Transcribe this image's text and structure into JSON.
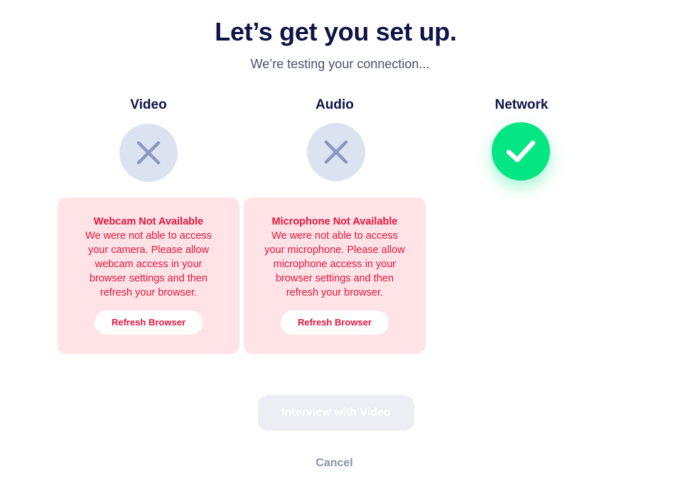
{
  "header": {
    "title": "Let’s get you set up.",
    "subtitle": "We’re testing your connection..."
  },
  "checks": [
    {
      "label": "Video",
      "status": "failed",
      "icon": "x-icon",
      "error_title": "Webcam Not Available",
      "error_message": "We were not able to access your camera. Please allow webcam access in your browser settings and then refresh your browser.",
      "button_label": "Refresh Browser"
    },
    {
      "label": "Audio",
      "status": "failed",
      "icon": "x-icon",
      "error_title": "Microphone Not Available",
      "error_message": "We were not able to access your microphone. Please allow microphone access in your browser settings and then refresh your browser.",
      "button_label": "Refresh Browser"
    },
    {
      "label": "Network",
      "status": "passed",
      "icon": "checkmark-icon"
    }
  ],
  "actions": {
    "primary_label": "Interview with Video",
    "primary_disabled": true,
    "cancel_label": "Cancel"
  },
  "colors": {
    "heading": "#0f1446",
    "error": "#e6163e",
    "error_bg": "#ffe3e6",
    "success": "#04e583",
    "fail_icon_bg": "#dbe3f1",
    "fail_icon": "#8a97c0"
  }
}
